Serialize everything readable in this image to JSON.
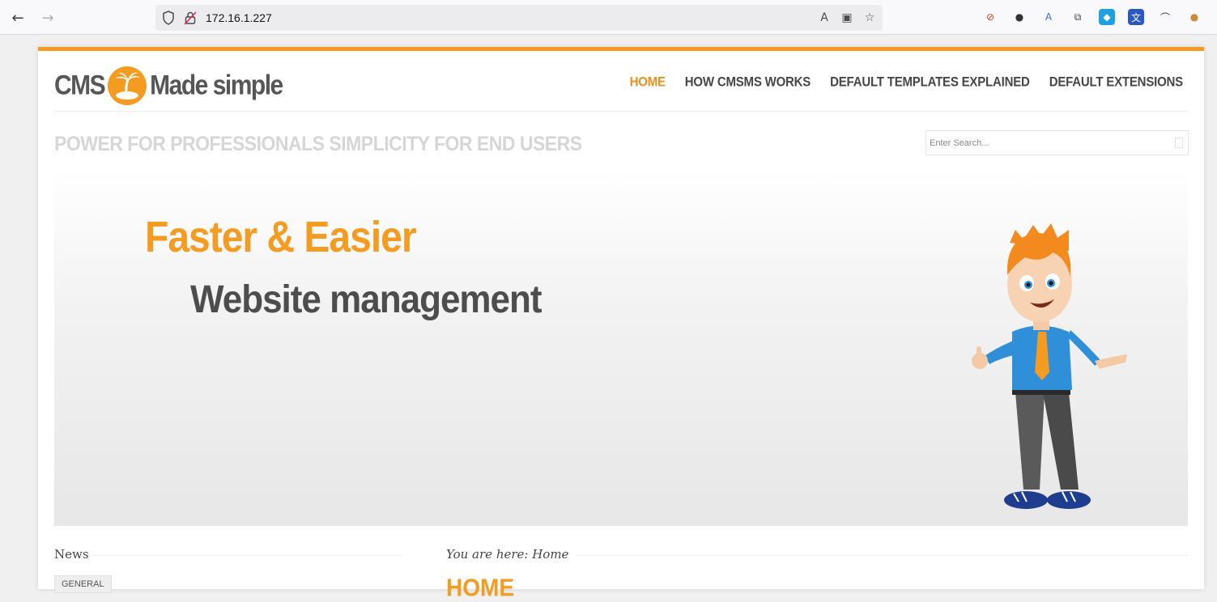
{
  "browser": {
    "url": "172.16.1.227",
    "back_icon": "arrow-left-icon",
    "forward_icon": "arrow-right-icon"
  },
  "site": {
    "logo_left": "CMS",
    "logo_right": "Made simple",
    "nav": [
      {
        "label": "HOME",
        "active": true
      },
      {
        "label": "HOW CMSMS WORKS",
        "active": false
      },
      {
        "label": "DEFAULT TEMPLATES EXPLAINED",
        "active": false
      },
      {
        "label": "DEFAULT EXTENSIONS",
        "active": false
      }
    ],
    "tagline": "POWER FOR PROFESSIONALS SIMPLICITY FOR END USERS",
    "search_placeholder": "Enter Search...",
    "accent_color": "#f39c21"
  },
  "banner": {
    "headline": "Faster & Easier",
    "subheadline": "Website management"
  },
  "sidebar": {
    "title": "News",
    "category": "GENERAL"
  },
  "content": {
    "breadcrumb": "You are here: Home",
    "title": "HOME"
  }
}
